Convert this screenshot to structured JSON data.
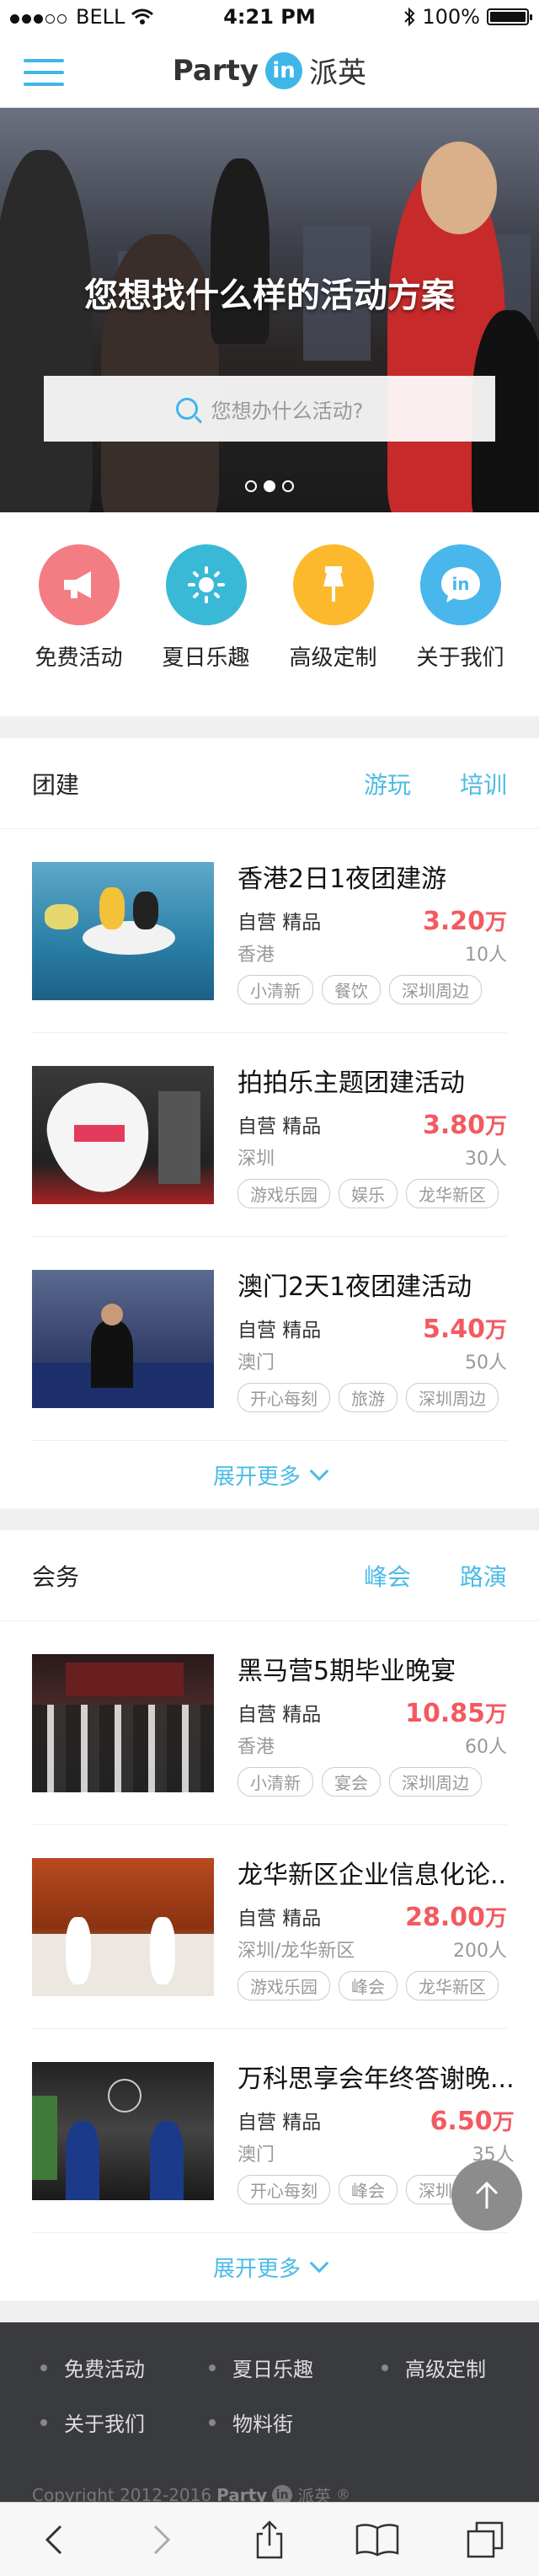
{
  "status_bar": {
    "carrier": "BELL",
    "time": "4:21 PM",
    "battery": "100%",
    "battery_level": 1.0
  },
  "header": {
    "logo_text": "Party",
    "logo_badge": "in",
    "logo_cn": "派英"
  },
  "hero": {
    "title": "您想找什么样的活动方案",
    "search_placeholder": "您想办什么活动?",
    "slides": 3,
    "active_slide": 1
  },
  "quick_nav": [
    {
      "label": "免费活动",
      "icon": "megaphone-icon",
      "color": "#f47d83"
    },
    {
      "label": "夏日乐趣",
      "icon": "sun-icon",
      "color": "#3ab9d6"
    },
    {
      "label": "高级定制",
      "icon": "pin-icon",
      "color": "#fcb92d"
    },
    {
      "label": "关于我们",
      "icon": "in-chat-icon",
      "color": "#49b7ec"
    }
  ],
  "sections": [
    {
      "title": "团建",
      "tabs": [
        "游玩",
        "培训"
      ],
      "items": [
        {
          "name": "香港2日1夜团建游",
          "type": "自营  精品",
          "price": "3.20",
          "unit": "万",
          "city": "香港",
          "people": "10人",
          "chips": [
            "小清新",
            "餐饮",
            "深圳周边"
          ],
          "thumb": "kayak"
        },
        {
          "name": "拍拍乐主题团建活动",
          "type": "自营  精品",
          "price": "3.80",
          "unit": "万",
          "city": "深圳",
          "people": "30人",
          "chips": [
            "游戏乐园",
            "娱乐",
            "龙华新区"
          ],
          "thumb": "heart"
        },
        {
          "name": "澳门2天1夜团建活动",
          "type": "自营  精品",
          "price": "5.40",
          "unit": "万",
          "city": "澳门",
          "people": "50人",
          "chips": [
            "开心每刻",
            "旅游",
            "深圳周边"
          ],
          "thumb": "conference"
        }
      ],
      "expand_label": "展开更多"
    },
    {
      "title": "会务",
      "tabs": [
        "峰会",
        "路演"
      ],
      "items": [
        {
          "name": "黑马营5期毕业晚宴",
          "type": "自营  精品",
          "price": "10.85",
          "unit": "万",
          "city": "香港",
          "people": "60人",
          "chips": [
            "小清新",
            "宴会",
            "深圳周边"
          ],
          "thumb": "crowd"
        },
        {
          "name": "龙华新区企业信息化论..",
          "type": "自营  精品",
          "price": "28.00",
          "unit": "万",
          "city": "深圳/龙华新区",
          "people": "200人",
          "chips": [
            "游戏乐园",
            "峰会",
            "龙华新区"
          ],
          "thumb": "forum"
        },
        {
          "name": "万科思享会年终答谢晚...",
          "type": "自营  精品",
          "price": "6.50",
          "unit": "万",
          "city": "澳门",
          "people": "35人",
          "chips": [
            "开心每刻",
            "峰会",
            "深圳周边"
          ],
          "thumb": "gala"
        }
      ],
      "expand_label": "展开更多"
    }
  ],
  "footer": {
    "links": [
      "免费活动",
      "夏日乐趣",
      "高级定制",
      "关于我们",
      "物料街"
    ],
    "copyright": "Copyright 2012-2016",
    "logo_text": "Party",
    "logo_badge": "in",
    "logo_cn": "派英",
    "registered": "®"
  }
}
